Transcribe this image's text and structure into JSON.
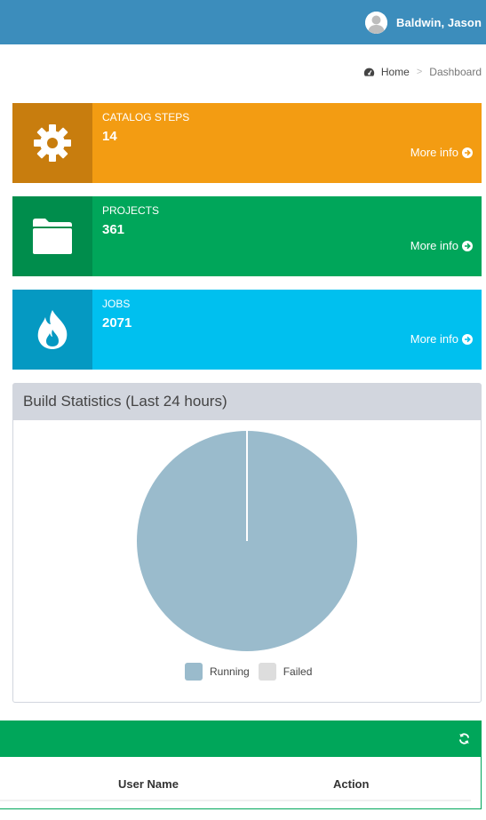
{
  "header": {
    "user_name": "Baldwin, Jason"
  },
  "breadcrumb": {
    "home": "Home",
    "separator": ">",
    "current": "Dashboard"
  },
  "info_boxes": [
    {
      "label": "CATALOG STEPS",
      "number": "14",
      "link": "More info",
      "icon": "gear-icon",
      "color": "#f39c12"
    },
    {
      "label": "PROJECTS",
      "number": "361",
      "link": "More info",
      "icon": "folder-icon",
      "color": "#00a65a"
    },
    {
      "label": "JOBS",
      "number": "2071",
      "link": "More info",
      "icon": "fire-icon",
      "color": "#00c0ef"
    }
  ],
  "build_stats": {
    "title": "Build Statistics (Last 24 hours)",
    "chart_data": {
      "type": "pie",
      "categories": [
        "Running",
        "Failed"
      ],
      "values": [
        100,
        0
      ],
      "colors": [
        "#9abbcc",
        "#dddddd"
      ],
      "legend": "bottom"
    }
  },
  "users_table": {
    "columns": [
      "User Name",
      "Action"
    ],
    "refresh_icon": "refresh-icon"
  }
}
